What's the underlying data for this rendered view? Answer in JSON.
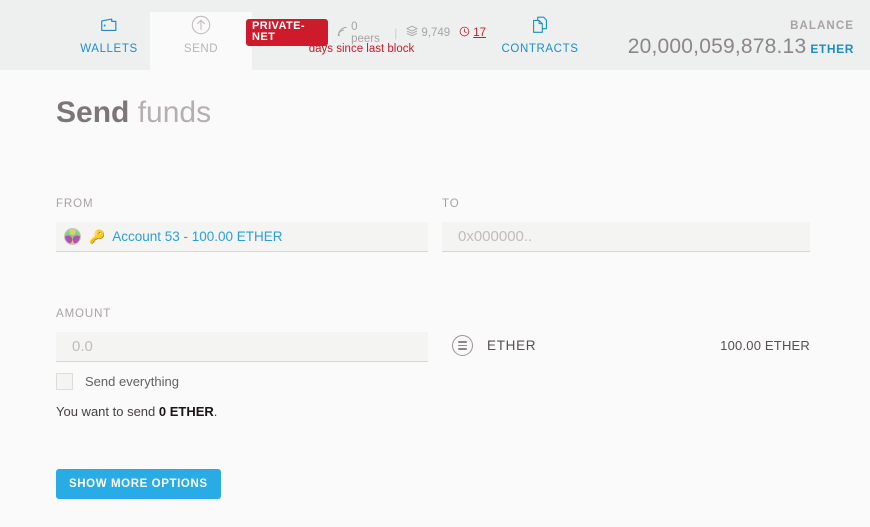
{
  "window": {
    "traffic_lights": [
      "close",
      "minimize",
      "maximize"
    ]
  },
  "header": {
    "tabs": [
      {
        "id": "wallets",
        "label": "WALLETS",
        "icon": "wallet-icon",
        "active": false
      },
      {
        "id": "send",
        "label": "SEND",
        "icon": "send-arrow-icon",
        "active": true
      },
      {
        "id": "contracts",
        "label": "CONTRACTS",
        "icon": "documents-icon",
        "active": false
      }
    ],
    "network": {
      "badge": "PRIVATE-NET",
      "peers": "0 peers",
      "peers_icon": "signal-icon",
      "separator": "|",
      "block_number": "9,749",
      "block_icon": "block-icon",
      "time_value": "17",
      "time_icon": "clock-icon",
      "sync_note": "days since last block",
      "badge_color": "#cd1b2b"
    },
    "balance": {
      "label": "BALANCE",
      "value": "20,000,059,878.13",
      "unit": "ETHER",
      "unit_color": "#1d8ec9"
    }
  },
  "main": {
    "title_bold": "Send",
    "title_light": " funds",
    "from": {
      "label": "FROM",
      "account_icon": "identicon",
      "key_icon": "🔑",
      "account_text": "Account 53 - 100.00 ETHER"
    },
    "to": {
      "label": "TO",
      "placeholder": "0x000000..",
      "value": ""
    },
    "amount": {
      "label": "AMOUNT",
      "placeholder": "0.0",
      "value": "",
      "send_everything_label": "Send everything",
      "send_everything_checked": false,
      "note_prefix": "You want to send ",
      "note_amount": "0 ETHER",
      "note_suffix": "."
    },
    "token_row": {
      "icon": "ether-token-icon",
      "name": "ETHER",
      "amount": "100.00 ETHER"
    },
    "show_more_button": "SHOW MORE OPTIONS",
    "accent_color": "#29abe6"
  }
}
